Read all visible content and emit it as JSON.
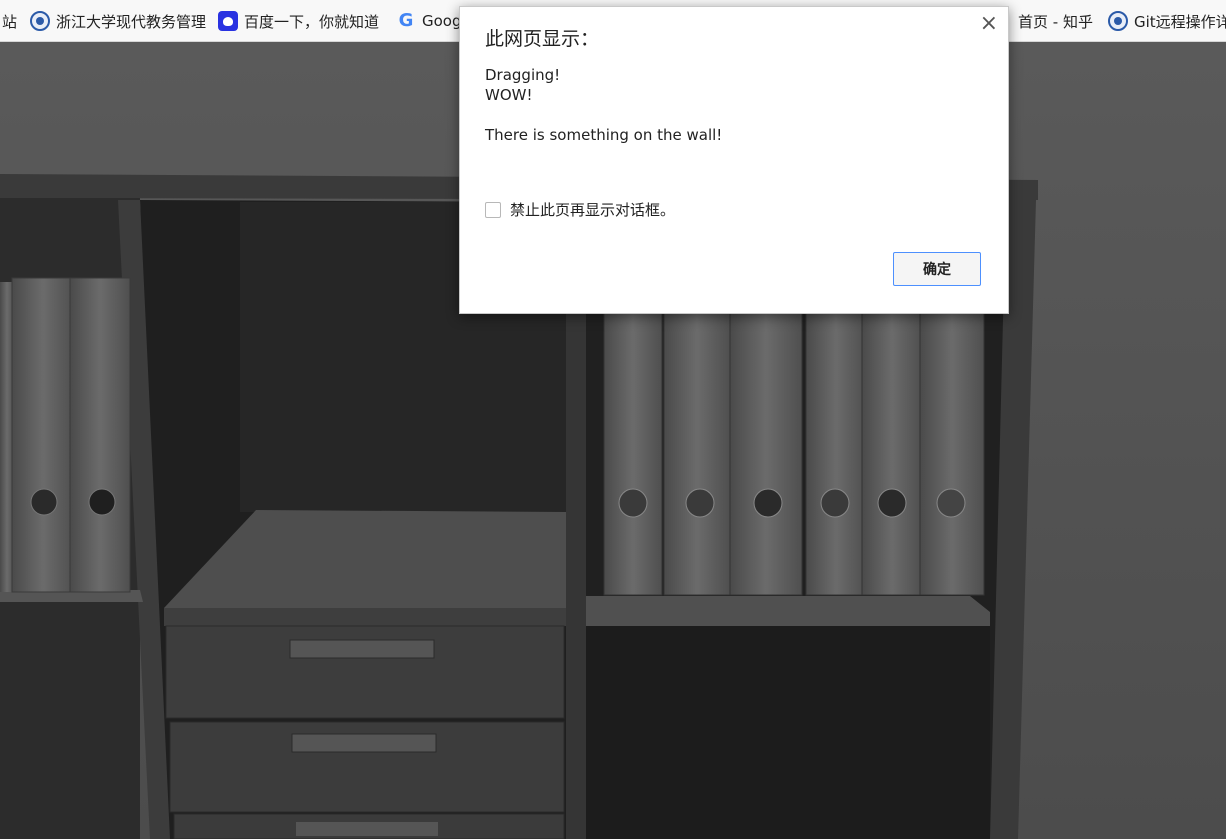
{
  "bookmarks": [
    {
      "label": "站",
      "icon": "none"
    },
    {
      "label": "浙江大学现代教务管理",
      "icon": "zju-logo-icon"
    },
    {
      "label": "百度一下，你就知道",
      "icon": "baidu-paw-icon"
    },
    {
      "label": "Goog",
      "icon": "google-g-icon"
    },
    {
      "label": "首页 - 知乎",
      "icon": "none"
    },
    {
      "label": "Git远程操作详",
      "icon": "zju-logo-icon"
    }
  ],
  "dialog": {
    "title": "此网页显示：",
    "close_glyph": "×",
    "message_lines": [
      "Dragging!",
      "WOW!",
      "",
      "There is something on the wall!"
    ],
    "checkbox_label": "禁止此页再显示对话框。",
    "checkbox_checked": false,
    "ok_label": "确定"
  },
  "scene": {
    "description_colors": {
      "background": "#555555",
      "cabinet": "#2a2a2a",
      "shelf": "#4a4a4a",
      "binder": "#5a5a5a"
    }
  }
}
